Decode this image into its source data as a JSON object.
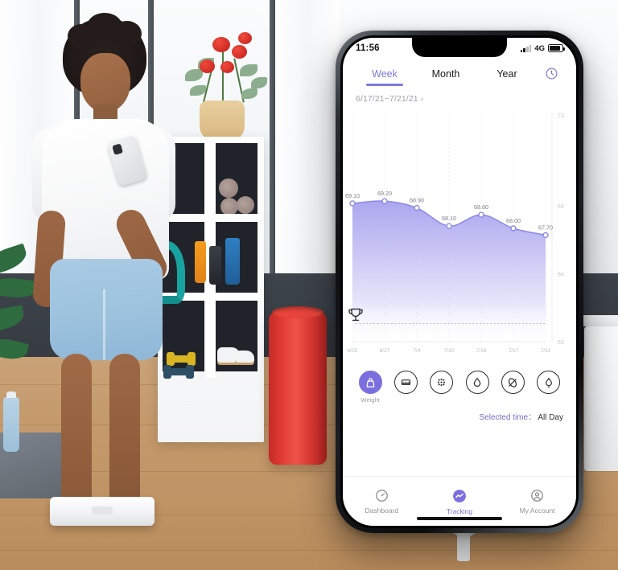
{
  "phone": {
    "status_bar": {
      "time": "11:56",
      "network": "4G",
      "signal_icon": "signal-bars-icon",
      "battery_icon": "battery-icon"
    },
    "tabs": [
      {
        "label": "Week",
        "active": true
      },
      {
        "label": "Month",
        "active": false
      },
      {
        "label": "Year",
        "active": false
      }
    ],
    "clock_icon": "clock-icon",
    "date_range": "6/17/21~7/21/21",
    "date_range_chevron": "›",
    "goal_icon": "trophy-icon",
    "metrics": [
      {
        "name": "weight",
        "label": "Weight",
        "icon": "weight-icon",
        "active": true
      },
      {
        "name": "bmi",
        "label": "",
        "icon": "bmi-icon",
        "active": false
      },
      {
        "name": "body-fat",
        "label": "",
        "icon": "body-fat-icon",
        "active": false
      },
      {
        "name": "water",
        "label": "",
        "icon": "water-drop-icon",
        "active": false
      },
      {
        "name": "muscle",
        "label": "",
        "icon": "muscle-icon",
        "active": false
      },
      {
        "name": "bmr",
        "label": "",
        "icon": "flame-icon",
        "active": false
      }
    ],
    "selected_time_label": "Selected time：",
    "selected_time_value": "All Day",
    "nav": [
      {
        "label": "Dashboard",
        "icon": "dashboard-icon",
        "active": false
      },
      {
        "label": "Tracking",
        "icon": "tracking-icon",
        "active": true
      },
      {
        "label": "My Account",
        "icon": "account-icon",
        "active": false
      }
    ],
    "colors": {
      "accent": "#7b6fe0",
      "tab_accent": "#7b78e0",
      "area_fill": "#a9a5ef",
      "text_muted": "#9ea1a8"
    }
  },
  "chart_data": {
    "type": "area",
    "title": "",
    "xlabel": "",
    "ylabel": "",
    "categories": [
      "6/25",
      "6/27",
      "7/4",
      "7/10",
      "7/16",
      "7/17",
      "7/21"
    ],
    "values": [
      69.1,
      69.2,
      68.9,
      68.1,
      68.6,
      68.0,
      67.7
    ],
    "point_labels": [
      "69.10",
      "69.20",
      "68.90",
      "68.10",
      "68.60",
      "68.00",
      "67.70"
    ],
    "ytick_labels": [
      "73",
      "69",
      "66",
      "63"
    ],
    "ylim": [
      63,
      73
    ],
    "grid": true,
    "legend": "none",
    "goal_line": 63.8,
    "line_color": "#8d88e8",
    "fill_top": "#a7a2ee",
    "fill_bottom": "#ffffff"
  }
}
